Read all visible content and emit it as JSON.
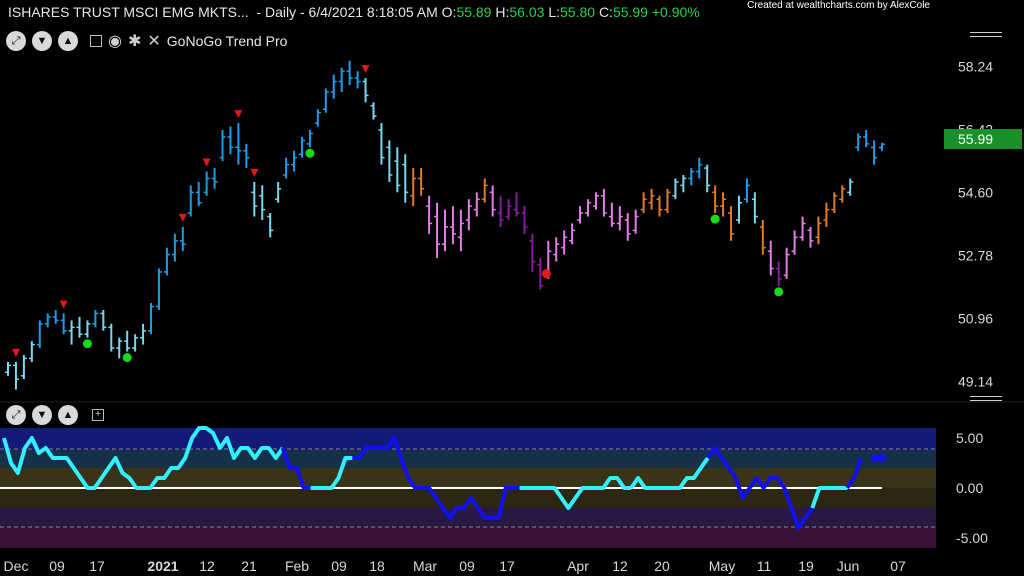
{
  "header": {
    "symbol": "ISHARES TRUST MSCI EMG MKTS...",
    "interval": "Daily",
    "datetime": "6/4/2021 8:18:05 AM",
    "open_label": "O:",
    "open": "55.89",
    "high_label": "H:",
    "high": "56.03",
    "low_label": "L:",
    "low": "55.80",
    "close_label": "C:",
    "close": "55.99",
    "change": "+0.90%",
    "credit": "Created at wealthcharts.com by AlexCole"
  },
  "toolbar": {
    "indicator_name": "GoNoGo Trend Pro"
  },
  "colors": {
    "strong_go": "#1e9be8",
    "go": "#7ad7f0",
    "neutral": "#e07b2a",
    "nogo": "#e57de6",
    "strong_nogo": "#8a1a9e",
    "price_marker": "#19a33b",
    "osc_cyan": "#33f0ff",
    "osc_blue": "#1010f0"
  },
  "chart_data": [
    {
      "type": "ohlc",
      "y_ticks": [
        "58.24",
        "56.42",
        "54.60",
        "52.78",
        "50.96",
        "49.14"
      ],
      "ylim": [
        48.6,
        59.0
      ],
      "last_price": "55.99",
      "x_ticks": [
        "Dec",
        "09",
        "17",
        "2021",
        "12",
        "21",
        "Feb",
        "09",
        "18",
        "Mar",
        "09",
        "17",
        "Apr",
        "12",
        "20",
        "May",
        "11",
        "19",
        "Jun",
        "07"
      ],
      "bars": [
        {
          "h": 49.7,
          "l": 49.3,
          "o": 49.4,
          "c": 49.6,
          "col": "go"
        },
        {
          "h": 49.7,
          "l": 48.9,
          "o": 49.6,
          "c": 49.2,
          "col": "go"
        },
        {
          "h": 49.9,
          "l": 49.2,
          "o": 49.3,
          "c": 49.8,
          "col": "go"
        },
        {
          "h": 50.3,
          "l": 49.7,
          "o": 49.8,
          "c": 50.2,
          "col": "go"
        },
        {
          "h": 50.9,
          "l": 50.1,
          "o": 50.2,
          "c": 50.8,
          "col": "strong_go"
        },
        {
          "h": 51.1,
          "l": 50.7,
          "o": 50.8,
          "c": 51.0,
          "col": "strong_go"
        },
        {
          "h": 51.2,
          "l": 50.8,
          "o": 51.0,
          "c": 50.9,
          "col": "strong_go"
        },
        {
          "h": 51.1,
          "l": 50.5,
          "o": 50.9,
          "c": 50.6,
          "col": "strong_go"
        },
        {
          "h": 50.9,
          "l": 50.2,
          "o": 50.6,
          "c": 50.7,
          "col": "go"
        },
        {
          "h": 51.0,
          "l": 50.4,
          "o": 50.7,
          "c": 50.5,
          "col": "go"
        },
        {
          "h": 50.9,
          "l": 50.4,
          "o": 50.5,
          "c": 50.8,
          "col": "go"
        },
        {
          "h": 51.2,
          "l": 50.7,
          "o": 50.8,
          "c": 51.1,
          "col": "strong_go"
        },
        {
          "h": 51.2,
          "l": 50.6,
          "o": 51.1,
          "c": 50.7,
          "col": "go"
        },
        {
          "h": 50.8,
          "l": 50.0,
          "o": 50.7,
          "c": 50.1,
          "col": "go"
        },
        {
          "h": 50.4,
          "l": 49.8,
          "o": 50.1,
          "c": 50.3,
          "col": "go"
        },
        {
          "h": 50.6,
          "l": 50.0,
          "o": 50.3,
          "c": 50.1,
          "col": "go"
        },
        {
          "h": 50.5,
          "l": 50.0,
          "o": 50.1,
          "c": 50.4,
          "col": "go"
        },
        {
          "h": 50.8,
          "l": 50.2,
          "o": 50.4,
          "c": 50.6,
          "col": "go"
        },
        {
          "h": 51.4,
          "l": 50.5,
          "o": 50.6,
          "c": 51.3,
          "col": "strong_go"
        },
        {
          "h": 52.4,
          "l": 51.2,
          "o": 51.3,
          "c": 52.3,
          "col": "strong_go"
        },
        {
          "h": 53.0,
          "l": 52.2,
          "o": 52.3,
          "c": 52.8,
          "col": "strong_go"
        },
        {
          "h": 53.4,
          "l": 52.6,
          "o": 52.8,
          "c": 53.2,
          "col": "strong_go"
        },
        {
          "h": 53.6,
          "l": 52.9,
          "o": 53.2,
          "c": 53.1,
          "col": "strong_go"
        },
        {
          "h": 54.8,
          "l": 53.9,
          "o": 54.0,
          "c": 54.6,
          "col": "strong_go"
        },
        {
          "h": 54.9,
          "l": 54.2,
          "o": 54.6,
          "c": 54.3,
          "col": "strong_go"
        },
        {
          "h": 55.2,
          "l": 54.5,
          "o": 54.6,
          "c": 55.0,
          "col": "strong_go"
        },
        {
          "h": 55.3,
          "l": 54.7,
          "o": 55.0,
          "c": 54.9,
          "col": "strong_go"
        },
        {
          "h": 56.4,
          "l": 55.5,
          "o": 55.6,
          "c": 56.2,
          "col": "strong_go"
        },
        {
          "h": 56.5,
          "l": 55.7,
          "o": 56.2,
          "c": 55.9,
          "col": "strong_go"
        },
        {
          "h": 56.6,
          "l": 55.4,
          "o": 55.9,
          "c": 55.8,
          "col": "strong_go"
        },
        {
          "h": 56.0,
          "l": 55.3,
          "o": 55.8,
          "c": 55.6,
          "col": "strong_go"
        },
        {
          "h": 54.9,
          "l": 53.9,
          "o": 54.6,
          "c": 54.2,
          "col": "go"
        },
        {
          "h": 54.8,
          "l": 53.8,
          "o": 54.5,
          "c": 54.1,
          "col": "go"
        },
        {
          "h": 54.0,
          "l": 53.3,
          "o": 53.9,
          "c": 53.5,
          "col": "go"
        },
        {
          "h": 54.9,
          "l": 54.3,
          "o": 54.4,
          "c": 54.7,
          "col": "go"
        },
        {
          "h": 55.6,
          "l": 55.0,
          "o": 55.1,
          "c": 55.4,
          "col": "strong_go"
        },
        {
          "h": 55.8,
          "l": 55.2,
          "o": 55.4,
          "c": 55.6,
          "col": "strong_go"
        },
        {
          "h": 56.2,
          "l": 55.6,
          "o": 55.7,
          "c": 56.1,
          "col": "strong_go"
        },
        {
          "h": 56.4,
          "l": 55.9,
          "o": 56.0,
          "c": 56.3,
          "col": "strong_go"
        },
        {
          "h": 57.0,
          "l": 56.5,
          "o": 56.6,
          "c": 56.9,
          "col": "strong_go"
        },
        {
          "h": 57.6,
          "l": 56.9,
          "o": 57.0,
          "c": 57.5,
          "col": "strong_go"
        },
        {
          "h": 58.0,
          "l": 57.3,
          "o": 57.5,
          "c": 57.8,
          "col": "strong_go"
        },
        {
          "h": 58.2,
          "l": 57.5,
          "o": 57.8,
          "c": 58.1,
          "col": "strong_go"
        },
        {
          "h": 58.4,
          "l": 57.7,
          "o": 58.1,
          "c": 57.9,
          "col": "strong_go"
        },
        {
          "h": 58.1,
          "l": 57.6,
          "o": 57.9,
          "c": 57.8,
          "col": "strong_go"
        },
        {
          "h": 57.9,
          "l": 57.2,
          "o": 57.8,
          "c": 57.4,
          "col": "go"
        },
        {
          "h": 57.2,
          "l": 56.7,
          "o": 57.1,
          "c": 56.8,
          "col": "go"
        },
        {
          "h": 56.6,
          "l": 55.4,
          "o": 56.4,
          "c": 55.6,
          "col": "go"
        },
        {
          "h": 56.1,
          "l": 54.9,
          "o": 55.9,
          "c": 55.1,
          "col": "go"
        },
        {
          "h": 55.9,
          "l": 54.6,
          "o": 55.5,
          "c": 54.8,
          "col": "go"
        },
        {
          "h": 55.7,
          "l": 54.3,
          "o": 55.4,
          "c": 54.6,
          "col": "go"
        },
        {
          "h": 55.3,
          "l": 54.2,
          "o": 54.5,
          "c": 55.0,
          "col": "neutral"
        },
        {
          "h": 55.3,
          "l": 54.5,
          "o": 55.0,
          "c": 54.7,
          "col": "neutral"
        },
        {
          "h": 54.5,
          "l": 53.4,
          "o": 54.2,
          "c": 53.7,
          "col": "nogo"
        },
        {
          "h": 54.3,
          "l": 52.7,
          "o": 53.9,
          "c": 53.1,
          "col": "nogo"
        },
        {
          "h": 54.1,
          "l": 52.9,
          "o": 53.1,
          "c": 53.6,
          "col": "nogo"
        },
        {
          "h": 54.2,
          "l": 53.1,
          "o": 53.6,
          "c": 53.4,
          "col": "nogo"
        },
        {
          "h": 54.1,
          "l": 52.9,
          "o": 53.3,
          "c": 53.7,
          "col": "nogo"
        },
        {
          "h": 54.4,
          "l": 53.5,
          "o": 53.8,
          "c": 54.2,
          "col": "nogo"
        },
        {
          "h": 54.6,
          "l": 53.9,
          "o": 54.1,
          "c": 54.4,
          "col": "nogo"
        },
        {
          "h": 55.0,
          "l": 54.3,
          "o": 54.4,
          "c": 54.8,
          "col": "neutral"
        },
        {
          "h": 54.8,
          "l": 53.9,
          "o": 54.6,
          "c": 54.1,
          "col": "nogo"
        },
        {
          "h": 54.5,
          "l": 53.6,
          "o": 54.0,
          "c": 53.8,
          "col": "strong_nogo"
        },
        {
          "h": 54.4,
          "l": 53.8,
          "o": 53.9,
          "c": 54.2,
          "col": "strong_nogo"
        },
        {
          "h": 54.6,
          "l": 53.9,
          "o": 54.1,
          "c": 54.0,
          "col": "strong_nogo"
        },
        {
          "h": 54.2,
          "l": 53.4,
          "o": 54.0,
          "c": 53.6,
          "col": "strong_nogo"
        },
        {
          "h": 53.4,
          "l": 52.3,
          "o": 53.2,
          "c": 52.6,
          "col": "strong_nogo"
        },
        {
          "h": 52.7,
          "l": 51.8,
          "o": 52.5,
          "c": 51.9,
          "col": "strong_nogo"
        },
        {
          "h": 53.2,
          "l": 52.1,
          "o": 52.3,
          "c": 52.9,
          "col": "nogo"
        },
        {
          "h": 53.3,
          "l": 52.6,
          "o": 52.8,
          "c": 53.1,
          "col": "nogo"
        },
        {
          "h": 53.5,
          "l": 52.8,
          "o": 53.0,
          "c": 53.3,
          "col": "nogo"
        },
        {
          "h": 53.7,
          "l": 53.1,
          "o": 53.2,
          "c": 53.5,
          "col": "nogo"
        },
        {
          "h": 54.2,
          "l": 53.7,
          "o": 53.8,
          "c": 54.0,
          "col": "nogo"
        },
        {
          "h": 54.4,
          "l": 53.9,
          "o": 54.0,
          "c": 54.3,
          "col": "nogo"
        },
        {
          "h": 54.6,
          "l": 54.1,
          "o": 54.2,
          "c": 54.5,
          "col": "nogo"
        },
        {
          "h": 54.7,
          "l": 53.9,
          "o": 54.5,
          "c": 54.0,
          "col": "nogo"
        },
        {
          "h": 54.3,
          "l": 53.6,
          "o": 53.9,
          "c": 53.7,
          "col": "nogo"
        },
        {
          "h": 54.2,
          "l": 53.5,
          "o": 53.7,
          "c": 53.9,
          "col": "nogo"
        },
        {
          "h": 54.0,
          "l": 53.2,
          "o": 53.8,
          "c": 53.4,
          "col": "nogo"
        },
        {
          "h": 54.1,
          "l": 53.4,
          "o": 53.5,
          "c": 53.9,
          "col": "nogo"
        },
        {
          "h": 54.6,
          "l": 54.0,
          "o": 54.1,
          "c": 54.4,
          "col": "neutral"
        },
        {
          "h": 54.7,
          "l": 54.1,
          "o": 54.3,
          "c": 54.5,
          "col": "neutral"
        },
        {
          "h": 54.5,
          "l": 53.9,
          "o": 54.4,
          "c": 54.1,
          "col": "neutral"
        },
        {
          "h": 54.7,
          "l": 54.0,
          "o": 54.1,
          "c": 54.6,
          "col": "neutral"
        },
        {
          "h": 55.0,
          "l": 54.4,
          "o": 54.5,
          "c": 54.9,
          "col": "go"
        },
        {
          "h": 55.1,
          "l": 54.6,
          "o": 54.8,
          "c": 55.0,
          "col": "go"
        },
        {
          "h": 55.3,
          "l": 54.8,
          "o": 55.0,
          "c": 55.2,
          "col": "strong_go"
        },
        {
          "h": 55.6,
          "l": 55.0,
          "o": 55.2,
          "c": 55.4,
          "col": "strong_go"
        },
        {
          "h": 55.4,
          "l": 54.6,
          "o": 55.3,
          "c": 54.8,
          "col": "go"
        },
        {
          "h": 54.8,
          "l": 54.0,
          "o": 54.6,
          "c": 54.2,
          "col": "neutral"
        },
        {
          "h": 54.6,
          "l": 53.9,
          "o": 54.2,
          "c": 54.4,
          "col": "neutral"
        },
        {
          "h": 54.2,
          "l": 53.2,
          "o": 54.0,
          "c": 53.4,
          "col": "neutral"
        },
        {
          "h": 54.5,
          "l": 53.7,
          "o": 53.8,
          "c": 54.3,
          "col": "go"
        },
        {
          "h": 55.0,
          "l": 54.3,
          "o": 54.4,
          "c": 54.8,
          "col": "strong_go"
        },
        {
          "h": 54.6,
          "l": 53.7,
          "o": 54.4,
          "c": 53.9,
          "col": "go"
        },
        {
          "h": 53.8,
          "l": 52.8,
          "o": 53.6,
          "c": 53.0,
          "col": "neutral"
        },
        {
          "h": 53.2,
          "l": 52.2,
          "o": 52.9,
          "c": 52.4,
          "col": "nogo"
        },
        {
          "h": 52.6,
          "l": 51.9,
          "o": 52.4,
          "c": 52.1,
          "col": "strong_nogo"
        },
        {
          "h": 53.0,
          "l": 52.1,
          "o": 52.2,
          "c": 52.8,
          "col": "nogo"
        },
        {
          "h": 53.5,
          "l": 52.8,
          "o": 52.9,
          "c": 53.3,
          "col": "nogo"
        },
        {
          "h": 53.9,
          "l": 53.2,
          "o": 53.3,
          "c": 53.7,
          "col": "nogo"
        },
        {
          "h": 53.6,
          "l": 53.0,
          "o": 53.5,
          "c": 53.2,
          "col": "nogo"
        },
        {
          "h": 53.9,
          "l": 53.1,
          "o": 53.3,
          "c": 53.7,
          "col": "neutral"
        },
        {
          "h": 54.3,
          "l": 53.6,
          "o": 53.8,
          "c": 54.1,
          "col": "neutral"
        },
        {
          "h": 54.6,
          "l": 54.0,
          "o": 54.1,
          "c": 54.5,
          "col": "neutral"
        },
        {
          "h": 54.8,
          "l": 54.3,
          "o": 54.4,
          "c": 54.7,
          "col": "neutral"
        },
        {
          "h": 55.0,
          "l": 54.5,
          "o": 54.6,
          "c": 54.9,
          "col": "go"
        },
        {
          "h": 56.3,
          "l": 55.8,
          "o": 55.9,
          "c": 56.2,
          "col": "strong_go"
        },
        {
          "h": 56.4,
          "l": 55.9,
          "o": 56.2,
          "c": 56.0,
          "col": "strong_go"
        },
        {
          "h": 56.1,
          "l": 55.4,
          "o": 55.9,
          "c": 55.6,
          "col": "strong_go"
        },
        {
          "h": 56.03,
          "l": 55.8,
          "o": 55.89,
          "c": 55.99,
          "col": "strong_go"
        }
      ],
      "signals": [
        {
          "i": 1,
          "type": "down",
          "col": "#e8151b"
        },
        {
          "i": 10,
          "type": "up",
          "col": "#19d91d"
        },
        {
          "i": 15,
          "type": "up",
          "col": "#19d91d"
        },
        {
          "i": 7,
          "type": "down",
          "col": "#e8151b"
        },
        {
          "i": 22,
          "type": "down",
          "col": "#e8151b"
        },
        {
          "i": 25,
          "type": "down",
          "col": "#e8151b"
        },
        {
          "i": 29,
          "type": "down",
          "col": "#e8151b"
        },
        {
          "i": 31,
          "type": "down",
          "col": "#e8151b"
        },
        {
          "i": 38,
          "type": "up",
          "col": "#19d91d"
        },
        {
          "i": 45,
          "type": "down",
          "col": "#e8151b"
        },
        {
          "i": 67,
          "type": "dot",
          "col": "#e8151b"
        },
        {
          "i": 89,
          "type": "up",
          "col": "#19d91d"
        },
        {
          "i": 97,
          "type": "up",
          "col": "#19d91d"
        },
        {
          "i": 112,
          "type": "down",
          "col": "#e8151b"
        }
      ]
    },
    {
      "type": "line",
      "name": "oscillator",
      "y_ticks": [
        "5.00",
        "0.00",
        "-5.00"
      ],
      "ylim": [
        -6,
        6
      ],
      "values": [
        5,
        2.5,
        1.5,
        4,
        5,
        3.5,
        4,
        3,
        3,
        3,
        2,
        1,
        0,
        0,
        1,
        2,
        3,
        1.5,
        1,
        0,
        0,
        0,
        1,
        1,
        2,
        2,
        3,
        5,
        6,
        6,
        5.5,
        4,
        5,
        3,
        4,
        4,
        3,
        4,
        4,
        3,
        4,
        2,
        2,
        0,
        0,
        0,
        0,
        0,
        1,
        3,
        3,
        3,
        4,
        4,
        4,
        4,
        5,
        3,
        1,
        0,
        0,
        0,
        -1,
        -2,
        -3,
        -2,
        -2,
        -1,
        -2,
        -3,
        -3,
        -3,
        0,
        0,
        0,
        0,
        0,
        0,
        0,
        0,
        -1,
        -2,
        -1,
        0,
        0,
        0,
        0,
        1,
        1,
        0,
        0,
        1,
        0,
        0,
        0,
        0,
        0,
        0,
        1,
        1,
        2,
        3,
        4,
        3,
        2,
        1,
        -1,
        0,
        1,
        0,
        1,
        1,
        0,
        -2,
        -4,
        -3,
        -2,
        0,
        0,
        0,
        0,
        0,
        1,
        3,
        5,
        3,
        3
      ],
      "segments": [
        {
          "from": 0,
          "to": 40,
          "col": "osc_cyan"
        },
        {
          "from": 40,
          "to": 44,
          "col": "osc_blue"
        },
        {
          "from": 44,
          "to": 50,
          "col": "osc_cyan"
        },
        {
          "from": 50,
          "to": 74,
          "col": "osc_blue"
        },
        {
          "from": 74,
          "to": 90,
          "col": "osc_cyan"
        },
        {
          "from": 90,
          "to": 101,
          "col": "osc_cyan"
        },
        {
          "from": 101,
          "to": 116,
          "col": "osc_blue"
        },
        {
          "from": 116,
          "to": 121,
          "col": "osc_cyan"
        },
        {
          "from": 121,
          "to": 123,
          "col": "osc_blue"
        }
      ]
    }
  ]
}
